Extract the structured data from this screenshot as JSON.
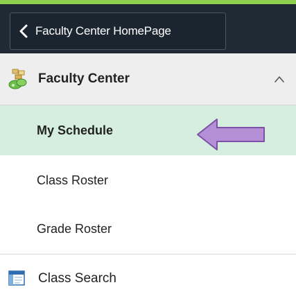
{
  "header": {
    "back_label": "Faculty Center HomePage"
  },
  "nav": {
    "section_title": "Faculty Center",
    "items": [
      {
        "label": "My Schedule",
        "active": true
      },
      {
        "label": "Class Roster",
        "active": false
      },
      {
        "label": "Grade Roster",
        "active": false
      }
    ],
    "class_search_label": "Class Search"
  },
  "icons": {
    "back": "chevron-left-icon",
    "section": "faculty-center-icon",
    "collapse": "chevron-up-icon",
    "class_search": "class-search-icon",
    "annotation": "purple-arrow-icon"
  },
  "colors": {
    "header_bg": "#1f2a35",
    "accent_bar": "#8fd14f",
    "active_item_bg": "#d6eedf",
    "arrow": "#b48fd6"
  }
}
